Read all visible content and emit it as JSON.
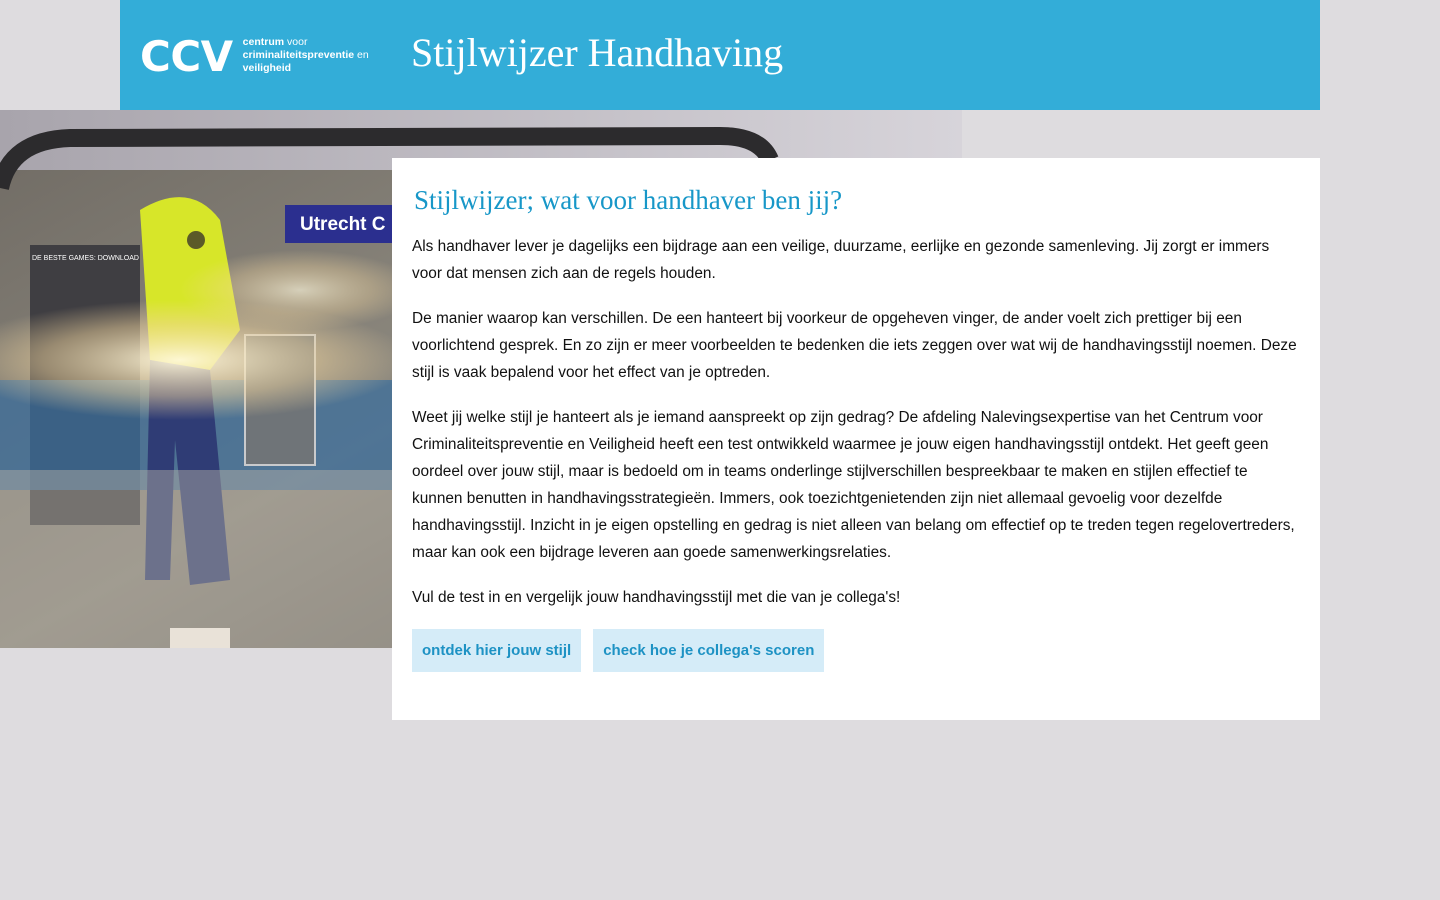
{
  "header": {
    "logo_mark": "CCV",
    "logo_line1_bold": "centrum",
    "logo_line1_rest": " voor",
    "logo_line2_bold": "criminaliteitspreventie",
    "logo_line2_rest": " en",
    "logo_line3_bold": "veiligheid",
    "title": "Stijlwijzer Handhaving"
  },
  "hero": {
    "sign_text": "Utrecht C",
    "poster_text": "DE BESTE GAMES: DOWNLOAD"
  },
  "main": {
    "heading": "Stijlwijzer; wat voor handhaver ben jij?",
    "paragraphs": [
      "Als handhaver lever je dagelijks een bijdrage aan een veilige, duurzame, eerlijke en gezonde samenleving. Jij zorgt er immers voor dat mensen zich aan de regels houden.",
      "De manier waarop kan verschillen. De een hanteert bij voorkeur de opgeheven vinger, de ander voelt zich prettiger bij een voorlichtend gesprek. En zo zijn er meer voorbeelden te bedenken die iets zeggen over wat wij de handhavingsstijl noemen. Deze stijl is vaak bepalend voor het effect van je optreden.",
      "Weet jij welke stijl je hanteert als je iemand aanspreekt op zijn gedrag? De afdeling Nalevingsexpertise van het Centrum voor Criminaliteitspreventie en Veiligheid heeft een test ontwikkeld waarmee je jouw eigen handhavingsstijl ontdekt. Het geeft geen oordeel over jouw stijl, maar is bedoeld om in teams onderlinge stijlverschillen bespreekbaar te maken en stijlen effectief te kunnen benutten in handhavingsstrategieën. Immers, ook toezichtgenietenden zijn niet allemaal gevoelig voor dezelfde handhavingsstijl. Inzicht in je eigen opstelling en gedrag is niet alleen van belang om effectief op te treden tegen regelovertreders, maar kan ook een bijdrage leveren aan goede samenwerkingsrelaties.",
      "Vul de test in en vergelijk jouw handhavingsstijl met die van je collega's!"
    ],
    "buttons": {
      "discover": "ontdek hier jouw stijl",
      "colleagues": "check hoe je collega's scoren"
    }
  },
  "colors": {
    "header_bg": "#33add8",
    "page_bg": "#dedcdf",
    "heading": "#1797c8",
    "button_bg": "#d5ecf8",
    "button_text": "#1d92c4"
  }
}
